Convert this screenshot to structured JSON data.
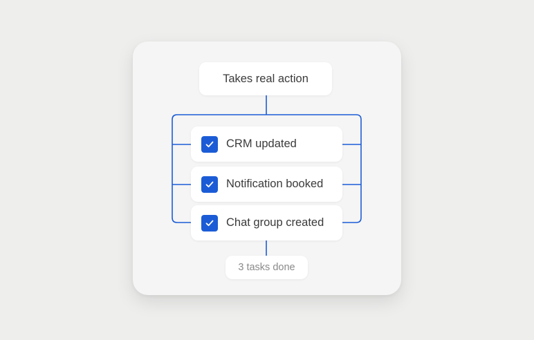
{
  "diagram": {
    "top_node": "Takes real action",
    "tasks": [
      {
        "label": "CRM updated",
        "checked": true,
        "icon": "checkbox-checked-icon"
      },
      {
        "label": "Notification booked",
        "checked": true,
        "icon": "checkbox-checked-icon"
      },
      {
        "label": "Chat group created",
        "checked": true,
        "icon": "checkbox-checked-icon"
      }
    ],
    "summary": "3 tasks done"
  },
  "colors": {
    "accent": "#1b5cd6",
    "connector": "#1b5cd6",
    "card_background": "#f5f5f5",
    "page_background": "#eeeeed"
  }
}
